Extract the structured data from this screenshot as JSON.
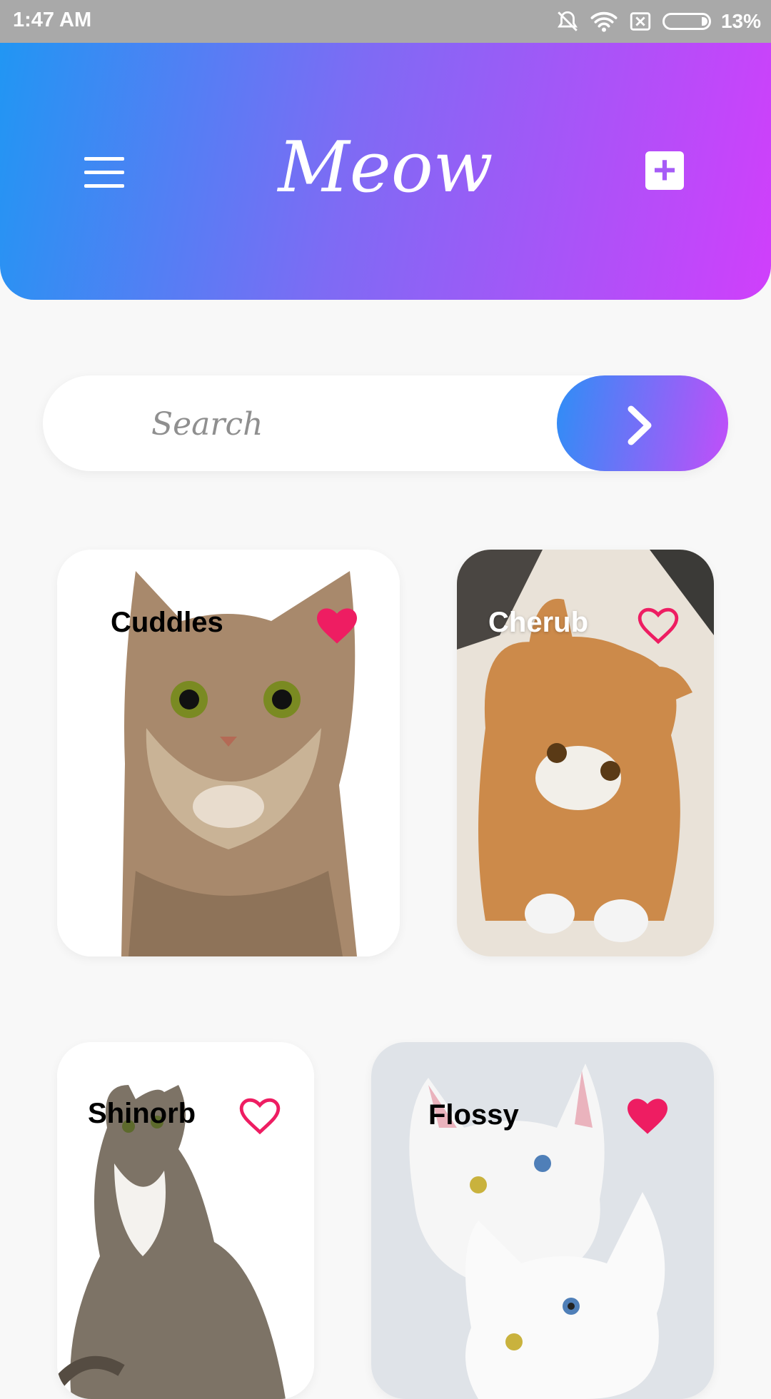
{
  "status_bar": {
    "time": "1:47 AM",
    "battery_percent": "13%",
    "icons": [
      "bell-off-icon",
      "wifi-icon",
      "no-sim-icon",
      "battery-icon"
    ]
  },
  "header": {
    "title": "Meow",
    "menu_icon": "hamburger-menu-icon",
    "add_icon": "plus-square-icon",
    "gradient": [
      "#2196f3",
      "#d03ffb"
    ]
  },
  "search": {
    "placeholder": "Search",
    "button_icon": "chevron-right-icon"
  },
  "cats": [
    {
      "name": "Cuddles",
      "favorite": true
    },
    {
      "name": "Cherub",
      "favorite": false
    },
    {
      "name": "Shinorb",
      "favorite": false
    },
    {
      "name": "Flossy",
      "favorite": true
    }
  ],
  "colors": {
    "heart": "#ee1d62",
    "background": "#f8f8f8"
  }
}
